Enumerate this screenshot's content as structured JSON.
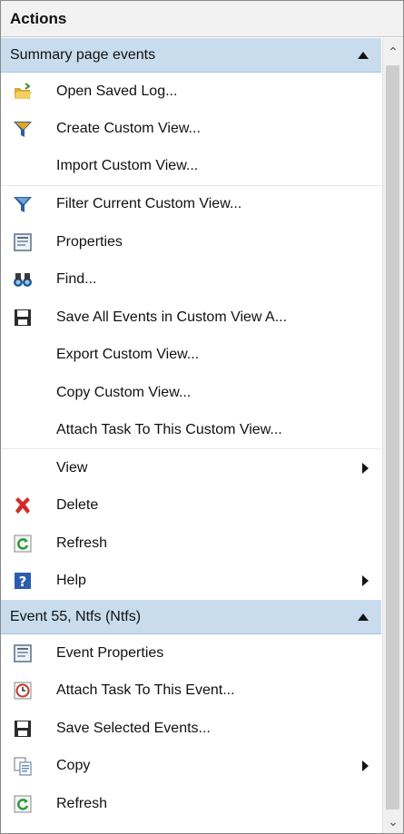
{
  "panel": {
    "title": "Actions"
  },
  "sections": [
    {
      "header": "Summary page events",
      "items": [
        {
          "label": "Open Saved Log...",
          "icon": "open-folder-icon"
        },
        {
          "label": "Create Custom View...",
          "icon": "funnel-star-icon"
        },
        {
          "label": "Import Custom View...",
          "icon": ""
        },
        {
          "label": "Filter Current Custom View...",
          "icon": "filter-icon"
        },
        {
          "label": "Properties",
          "icon": "properties-icon"
        },
        {
          "label": "Find...",
          "icon": "binoculars-icon"
        },
        {
          "label": "Save All Events in Custom View A...",
          "icon": "save-icon"
        },
        {
          "label": "Export Custom View...",
          "icon": ""
        },
        {
          "label": "Copy Custom View...",
          "icon": ""
        },
        {
          "label": "Attach Task To This Custom View...",
          "icon": ""
        },
        {
          "label": "View",
          "icon": "",
          "submenu": true
        },
        {
          "label": "Delete",
          "icon": "delete-x-icon"
        },
        {
          "label": "Refresh",
          "icon": "refresh-icon"
        },
        {
          "label": "Help",
          "icon": "help-icon",
          "submenu": true
        }
      ]
    },
    {
      "header": "Event 55, Ntfs (Ntfs)",
      "items": [
        {
          "label": "Event Properties",
          "icon": "properties-icon"
        },
        {
          "label": "Attach Task To This Event...",
          "icon": "task-clock-icon"
        },
        {
          "label": "Save Selected Events...",
          "icon": "save-icon"
        },
        {
          "label": "Copy",
          "icon": "copy-icon",
          "submenu": true
        },
        {
          "label": "Refresh",
          "icon": "refresh-icon"
        }
      ]
    }
  ],
  "colors": {
    "section_header_bg": "#c8dcee",
    "delete_red": "#d42a2a",
    "help_blue": "#2a5db0",
    "refresh_green": "#2e9b3a"
  }
}
